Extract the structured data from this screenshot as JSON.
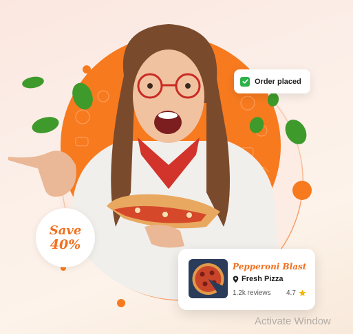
{
  "order_status": {
    "label": "Order placed"
  },
  "promo": {
    "line1": "Save",
    "line2": "40%"
  },
  "product": {
    "name": "Pepperoni Blast",
    "location": "Fresh Pizza",
    "reviews": "1.2k reviews",
    "rating": "4.7"
  },
  "system": {
    "watermark": "Activate Window"
  },
  "colors": {
    "accent": "#f07020",
    "check": "#2db24a",
    "star": "#f5b400",
    "leaf": "#3e9a2b"
  },
  "icons": [
    "check-icon",
    "location-pin-icon",
    "star-icon"
  ]
}
